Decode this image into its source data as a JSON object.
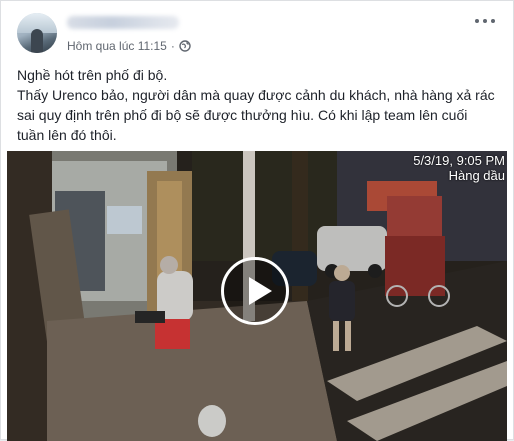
{
  "post": {
    "timestamp": "Hôm qua lúc 11:15",
    "privacy_icon": "globe-icon",
    "options_icon": "more-options-icon",
    "lines": [
      "Nghề hót trên phố đi bộ.",
      "Thấy Urenco bảo, người dân mà quay được cảnh du khách, nhà hàng xả rác sai quy định trên phố đi bộ sẽ được thưởng hìu. Có khi lập team lên cuối tuần lên đó thôi."
    ]
  },
  "video": {
    "date_stamp": "5/3/19, 9:05 PM",
    "sign_text": "Hàng dầu",
    "play_icon": "play-icon"
  },
  "colors": {
    "text": "#1d2129",
    "meta": "#616770",
    "card_border": "#dddfe2",
    "background": "#e9ebee"
  }
}
